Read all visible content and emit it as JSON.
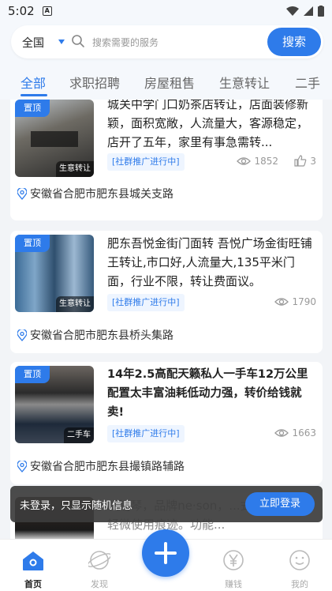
{
  "status_bar": {
    "time": "5:02",
    "notif_icon": "A"
  },
  "search": {
    "region": "全国",
    "placeholder": "搜索需要的服务",
    "button": "搜索"
  },
  "tabs": [
    "全部",
    "求职招聘",
    "房屋租售",
    "生意转让",
    "二手"
  ],
  "posts": [
    {
      "title": "城关中学门口奶茶店转让，店面装修新颖，面积宽敞，人流量大，客源稳定，店开了五年，家里有事急需转...",
      "category": "生意转让",
      "pinned": "置顶",
      "promo": "[社群推广进行中]",
      "views": "1852",
      "likes": "3",
      "location": "安徽省合肥市肥东县城关支路"
    },
    {
      "title": "肥东吾悦金街门面转 吾悦广场金街旺铺王转让,市口好,人流量大,135平米门面，行业不限，转让费面议。",
      "category": "生意转让",
      "pinned": "置顶",
      "promo": "[社群推广进行中]",
      "views": "1790",
      "location": "安徽省合肥市肥东县桥头集路"
    },
    {
      "title": "14年2.5高配天籁私人一手车12万公里配置太丰富油耗低动力强，转价给钱就卖!",
      "category": "二手车",
      "pinned": "置顶",
      "promo": "[社群推广进行中]",
      "views": "1663",
      "location": "安徽省合肥市肥东县撮镇路辅路"
    },
    {
      "title": "...钢琴，品牌ne·son，...式设计，...有轻微使用痕迹。功能..."
    }
  ],
  "toast": {
    "message": "未登录，只显示随机信息",
    "button": "立即登录"
  },
  "bottom_nav": [
    {
      "label": "首页",
      "icon": "home-icon"
    },
    {
      "label": "发现",
      "icon": "discover-icon"
    },
    {
      "label": "",
      "icon": "plus-icon"
    },
    {
      "label": "赚钱",
      "icon": "yen-icon"
    },
    {
      "label": "我的",
      "icon": "smile-icon"
    }
  ],
  "colors": {
    "accent": "#2e7bea",
    "background": "#f2f4f7"
  }
}
